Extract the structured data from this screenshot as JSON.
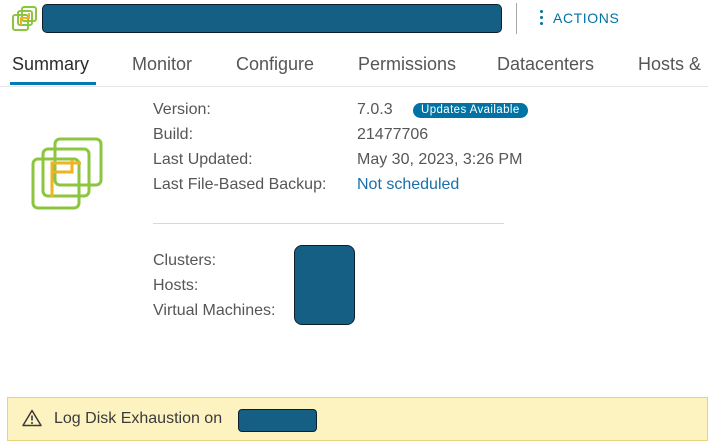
{
  "header": {
    "actions_label": "ACTIONS"
  },
  "tabs": [
    {
      "label": "Summary",
      "active": true
    },
    {
      "label": "Monitor",
      "active": false
    },
    {
      "label": "Configure",
      "active": false
    },
    {
      "label": "Permissions",
      "active": false
    },
    {
      "label": "Datacenters",
      "active": false
    },
    {
      "label": "Hosts &",
      "active": false
    }
  ],
  "summary": {
    "version_label": "Version:",
    "version_value": "7.0.3",
    "update_badge": "Updates Available",
    "build_label": "Build:",
    "build_value": "21477706",
    "last_updated_label": "Last Updated:",
    "last_updated_value": "May 30, 2023, 3:26 PM",
    "backup_label": "Last File-Based Backup:",
    "backup_value": "Not scheduled",
    "clusters_label": "Clusters:",
    "hosts_label": "Hosts:",
    "vms_label": "Virtual Machines:"
  },
  "alert": {
    "text": "Log Disk Exhaustion on"
  },
  "colors": {
    "accent": "#0072a3",
    "tab_underline": "#0079b8",
    "logo_green": "#8cc63f",
    "logo_yellow": "#f0b323",
    "alert_bg": "#fdf3c1",
    "redaction": "#155e84"
  },
  "icons": {
    "header": "vcenter-icon",
    "logo": "vsphere-logo-icon",
    "actions": "kebab-icon",
    "alert": "warning-triangle-icon"
  }
}
